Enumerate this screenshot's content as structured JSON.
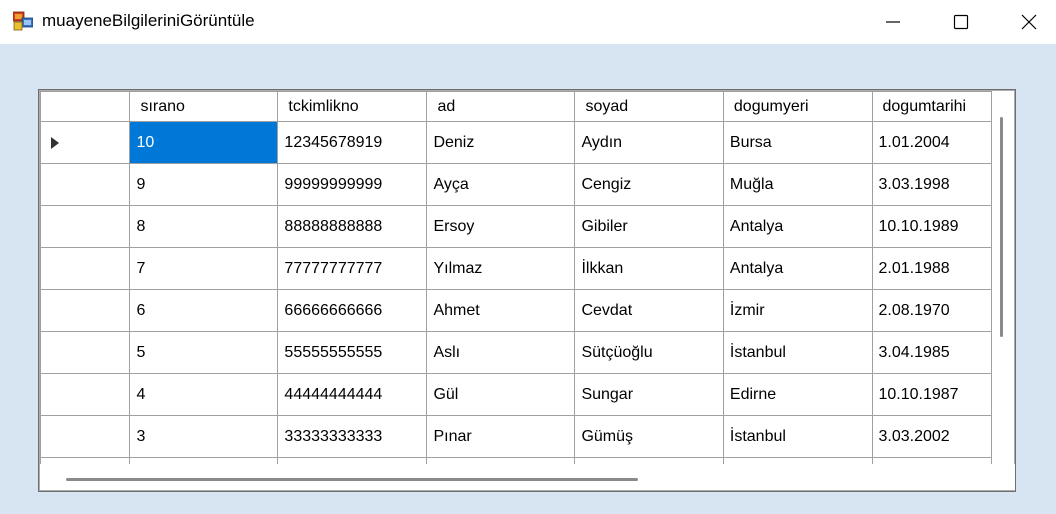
{
  "window": {
    "title": "muayeneBilgileriniGörüntüle"
  },
  "grid": {
    "columns": [
      "sırano",
      "tckimlikno",
      "ad",
      "soyad",
      "dogumyeri",
      "dogumtarihi"
    ],
    "rows": [
      [
        "10",
        "12345678919",
        "Deniz",
        "Aydın",
        "Bursa",
        "1.01.2004"
      ],
      [
        "9",
        "99999999999",
        "Ayça",
        "Cengiz",
        "Muğla",
        "3.03.1998"
      ],
      [
        "8",
        "88888888888",
        "Ersoy",
        "Gibiler",
        "Antalya",
        "10.10.1989"
      ],
      [
        "7",
        "77777777777",
        "Yılmaz",
        "İlkkan",
        "Antalya",
        "2.01.1988"
      ],
      [
        "6",
        "66666666666",
        "Ahmet",
        "Cevdat",
        "İzmir",
        "2.08.1970"
      ],
      [
        "5",
        "55555555555",
        "Aslı",
        "Sütçüoğlu",
        "İstanbul",
        "3.04.1985"
      ],
      [
        "4",
        "44444444444",
        "Gül",
        "Sungar",
        "Edirne",
        "10.10.1987"
      ],
      [
        "3",
        "33333333333",
        "Pınar",
        "Gümüş",
        "İstanbul",
        "3.03.2002"
      ]
    ],
    "selected_row": 0,
    "selected_col": 0
  },
  "colors": {
    "client_bg": "#d7e4f2",
    "selection": "#0078d7"
  }
}
